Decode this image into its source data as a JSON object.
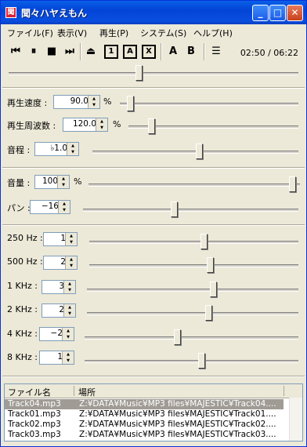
{
  "window": {
    "title": "聞々ハヤえもん",
    "app_icon": "聞"
  },
  "controls": {
    "minimize": "_",
    "maximize": "□",
    "close": "✕"
  },
  "menu": [
    "ファイル(F)",
    "表示(V)",
    "再生(P)",
    "システム(S)",
    "ヘルプ(H)"
  ],
  "toolbar": {
    "icons": [
      "previous-icon",
      "pause-icon",
      "stop-icon",
      "next-icon",
      "eject-icon",
      "repeat-one-icon",
      "repeat-all-icon",
      "random-icon",
      "ab-repeat-a-icon",
      "ab-repeat-b-icon",
      "playlist-icon"
    ],
    "glyphs": [
      "⏮",
      "⏸",
      "■",
      "⏭",
      "⏏",
      "1",
      "A",
      "X",
      "A",
      "B",
      "☰"
    ],
    "time": "02:50 / 06:22"
  },
  "position": {
    "fraction": 0.45
  },
  "speed": {
    "label": "再生速度 :",
    "value": "90.0",
    "unit": "%",
    "fraction": 0.04
  },
  "frequency": {
    "label": "再生周波数 :",
    "value": "120.0",
    "unit": "%",
    "fraction": 0.12
  },
  "pitch": {
    "label": "音程 :",
    "value": "♭1.0",
    "fraction": 0.52
  },
  "volume": {
    "label": "音量 :",
    "value": "100",
    "unit": "%",
    "fraction": 1.0
  },
  "pan": {
    "label": "パン :",
    "value": "−16",
    "fraction": 0.42
  },
  "eq": [
    {
      "label": "250 Hz :",
      "value": "1",
      "fraction": 0.55
    },
    {
      "label": "500 Hz :",
      "value": "2",
      "fraction": 0.58
    },
    {
      "label": "1 KHz :",
      "value": "3",
      "fraction": 0.6
    },
    {
      "label": "2 KHz :",
      "value": "2",
      "fraction": 0.58
    },
    {
      "label": "4 KHz :",
      "value": "−2",
      "fraction": 0.43
    },
    {
      "label": "8 KHz :",
      "value": "1",
      "fraction": 0.55
    }
  ],
  "playlist": {
    "headers": [
      "ファイル名",
      "場所"
    ],
    "rows": [
      {
        "name": "Track04.mp3",
        "path": "Z:¥DATA¥Music¥MP3 files¥MAJESTIC¥Track04....",
        "selected": true
      },
      {
        "name": "Track01.mp3",
        "path": "Z:¥DATA¥Music¥MP3 files¥MAJESTIC¥Track01....",
        "selected": false
      },
      {
        "name": "Track02.mp3",
        "path": "Z:¥DATA¥Music¥MP3 files¥MAJESTIC¥Track02....",
        "selected": false
      },
      {
        "name": "Track03.mp3",
        "path": "Z:¥DATA¥Music¥MP3 files¥MAJESTIC¥Track03....",
        "selected": false
      }
    ]
  }
}
